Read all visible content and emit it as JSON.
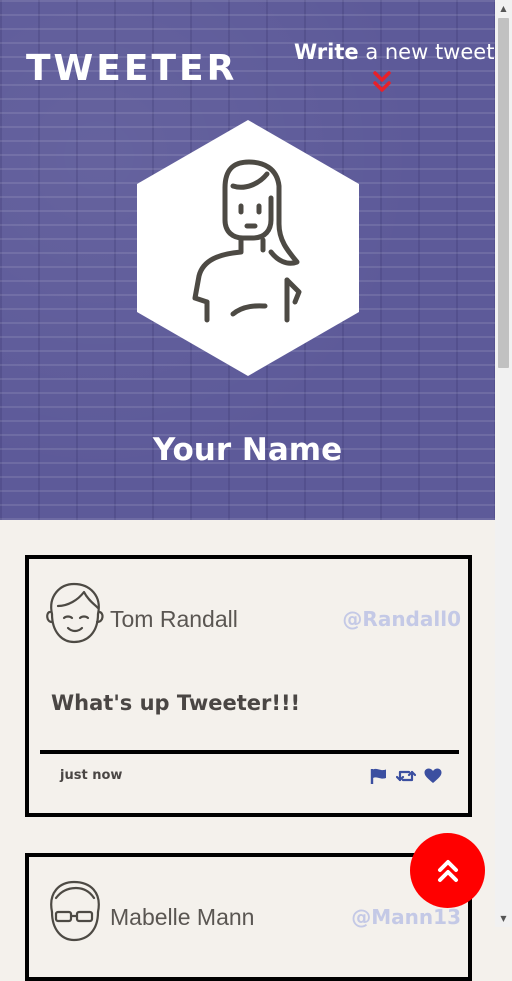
{
  "header": {
    "brand": "TWEETER",
    "write_strong": "Write",
    "write_rest": " a new tweet",
    "profile_name": "Your Name",
    "accent_color": "#5d5a99",
    "chevron_color": "#e8202a",
    "icons": [
      "double-chevron-down-icon",
      "profile-avatar-icon"
    ]
  },
  "tweets": [
    {
      "name": "Tom Randall",
      "handle": "@Randall0",
      "content": "What's up Tweeter!!!",
      "time": "just now",
      "avatar_icon": "boy-avatar-icon",
      "actions": [
        "flag-icon",
        "retweet-icon",
        "heart-icon"
      ]
    },
    {
      "name": "Mabelle Mann",
      "handle": "@Mann13",
      "avatar_icon": "girl-glasses-avatar-icon"
    }
  ],
  "fab": {
    "icon": "double-chevron-up-icon",
    "color": "#ff0000"
  },
  "colors": {
    "page_background": "#f4f1ec",
    "handle": "#c4c9e6",
    "action_icons": "#3b4fa0"
  }
}
